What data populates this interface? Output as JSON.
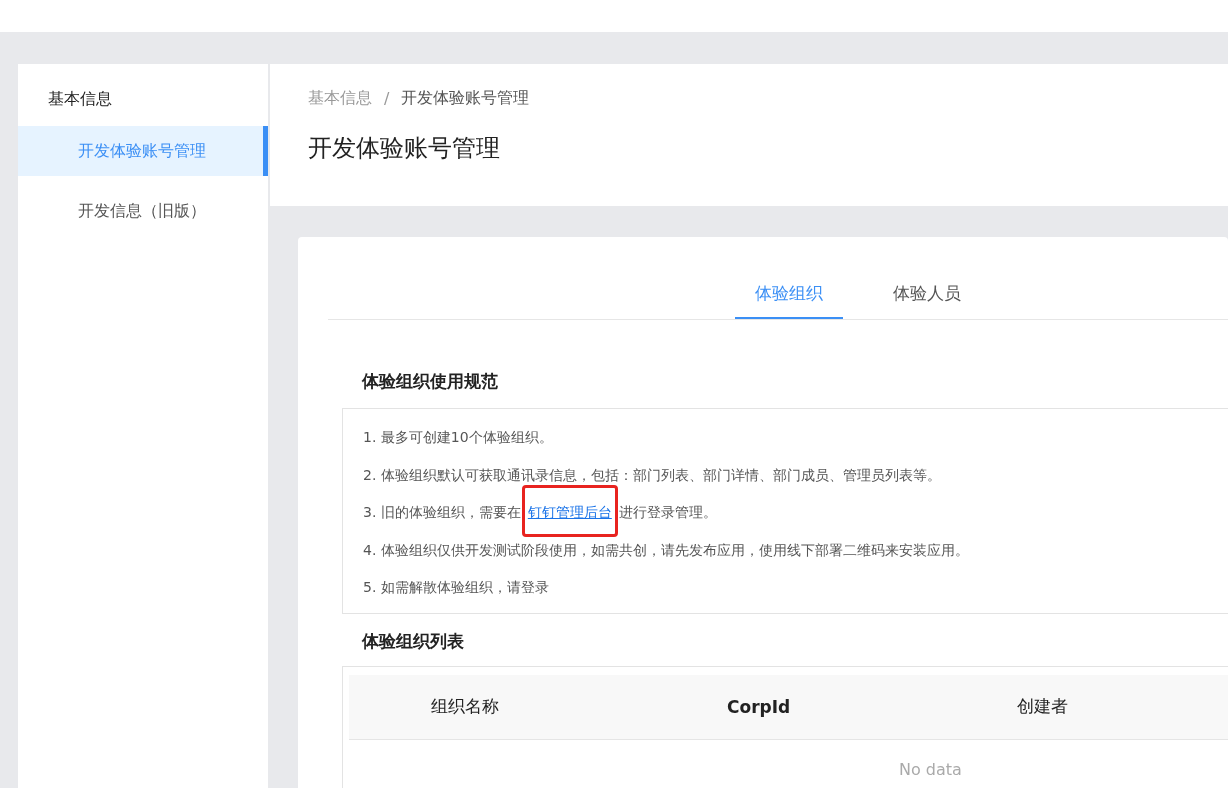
{
  "sidebar": {
    "title": "基本信息",
    "items": [
      {
        "label": "开发体验账号管理",
        "selected": true
      },
      {
        "label": "开发信息（旧版）",
        "selected": false
      }
    ]
  },
  "breadcrumb": [
    "基本信息",
    "/",
    "开发体验账号管理"
  ],
  "page_title": "开发体验账号管理",
  "tabs": [
    {
      "label": "体验组织",
      "selected": true
    },
    {
      "label": "体验人员",
      "selected": false
    }
  ],
  "rules": {
    "title": "体验组织使用规范",
    "items": [
      {
        "kind": "text",
        "text": "1. 最多可创建10个体验组织。"
      },
      {
        "kind": "text",
        "text": "2. 体验组织默认可获取通讯录信息，包括：部门列表、部门详情、部门成员、管理员列表等。"
      },
      {
        "kind": "link",
        "before": "3. 旧的体验组织，需要在",
        "link": "钉钉管理后台",
        "after": "进行登录管理。"
      },
      {
        "kind": "text",
        "text": "4. 体验组织仅供开发测试阶段使用，如需共创，请先发布应用，使用线下部署二维码来安装应用。"
      },
      {
        "kind": "text",
        "text": "5. 如需解散体验组织，请登录"
      }
    ]
  },
  "table": {
    "title": "体验组织列表",
    "columns": [
      "组织名称",
      "CorpId",
      "创建者"
    ],
    "empty_text": "No data"
  }
}
